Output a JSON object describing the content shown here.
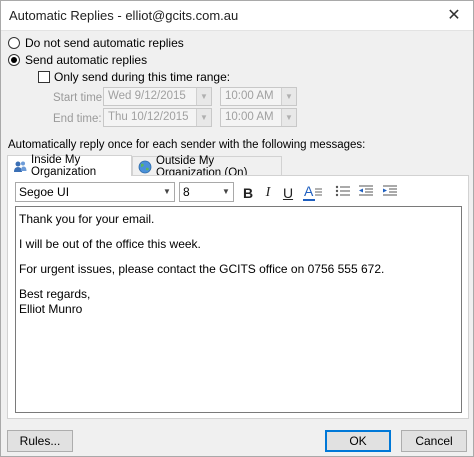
{
  "window": {
    "title": "Automatic Replies - elliot@gcits.com.au",
    "close": "✕"
  },
  "options": {
    "no_replies": "Do not send automatic replies",
    "send_replies": "Send automatic replies",
    "selected": "send_replies"
  },
  "time_range": {
    "checkbox_label": "Only send during this time range:",
    "checked": false,
    "start_label": "Start time:",
    "start_date": "Wed 9/12/2015",
    "start_time": "10:00 AM",
    "end_label": "End time:",
    "end_date": "Thu 10/12/2015",
    "end_time": "10:00 AM"
  },
  "instructions": "Automatically reply once for each sender with the following messages:",
  "tabs": [
    {
      "label": "Inside My Organization",
      "active": true,
      "icon": "people-icon"
    },
    {
      "label": "Outside My Organization (On)",
      "active": false,
      "icon": "globe-icon"
    }
  ],
  "toolbar": {
    "font_name": "Segoe UI",
    "font_size": "8",
    "bold": "B",
    "italic": "I",
    "underline": "U",
    "font_color": "A"
  },
  "message": {
    "lines": [
      "Thank you for your email.",
      "I will be out of the office this week.",
      "For urgent issues, please contact the GCITS office on 0756 555 672.",
      "Best regards,",
      "Elliot Munro"
    ]
  },
  "buttons": {
    "rules": "Rules...",
    "ok": "OK",
    "cancel": "Cancel"
  },
  "colors": {
    "accent": "#0078d7",
    "font_color_bar": "#1f5fbf"
  }
}
